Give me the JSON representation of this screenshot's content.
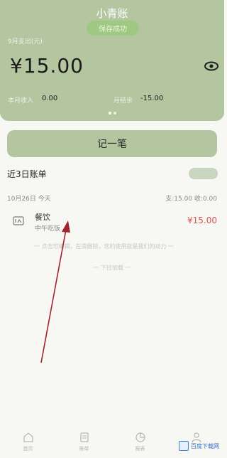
{
  "header": {
    "app_title": "小青账",
    "toast": "保存成功",
    "month_label": "9月支出(元)",
    "amount": "¥15.00",
    "income_label": "本月收入",
    "income_value": "0.00",
    "balance_label": "月结余",
    "balance_value": "-15.00"
  },
  "record_button": "记一笔",
  "recent": {
    "title": "近3日账单",
    "toggle": "",
    "date": "10月26日 今天",
    "summary": "支:15.00 收:0.00"
  },
  "entries": [
    {
      "category": "餐饮",
      "note": "中午吃饭",
      "amount": "¥15.00",
      "icon": "food-icon"
    }
  ],
  "hints": {
    "line": "一 点击可编辑，左滑删除，您的使用就是我们的动力 一",
    "more": "一 下拉加载 一"
  },
  "nav": [
    {
      "label": "首页",
      "icon": "home-icon"
    },
    {
      "label": "账单",
      "icon": "bill-icon"
    },
    {
      "label": "报表",
      "icon": "chart-icon"
    },
    {
      "label": "",
      "icon": "user-icon"
    }
  ],
  "watermark": "百度下载网",
  "colors": {
    "header_green": "#b3c6a0",
    "expense_red": "#d9534f",
    "annotation_arrow": "#a0242f"
  }
}
